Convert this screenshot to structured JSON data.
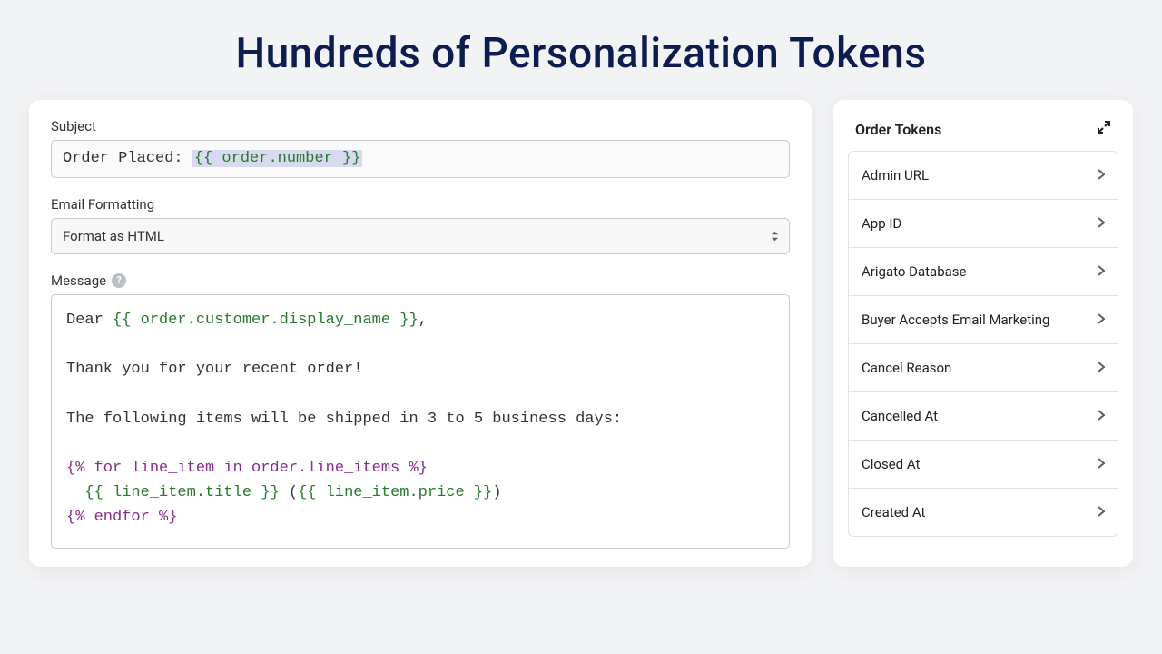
{
  "header": {
    "title": "Hundreds of Personalization Tokens"
  },
  "form": {
    "subject_label": "Subject",
    "subject_prefix": "Order Placed: ",
    "subject_token": "{{ order.number }}",
    "formatting_label": "Email Formatting",
    "formatting_value": "Format as HTML",
    "message_label": "Message",
    "message_lines": [
      {
        "parts": [
          {
            "t": "plain",
            "v": "Dear "
          },
          {
            "t": "var",
            "v": "{{ order.customer.display_name }}"
          },
          {
            "t": "plain",
            "v": ","
          }
        ]
      },
      {
        "parts": [
          {
            "t": "plain",
            "v": ""
          }
        ]
      },
      {
        "parts": [
          {
            "t": "plain",
            "v": "Thank you for your recent order!"
          }
        ]
      },
      {
        "parts": [
          {
            "t": "plain",
            "v": ""
          }
        ]
      },
      {
        "parts": [
          {
            "t": "plain",
            "v": "The following items will be shipped in 3 to 5 business days:"
          }
        ]
      },
      {
        "parts": [
          {
            "t": "plain",
            "v": ""
          }
        ]
      },
      {
        "parts": [
          {
            "t": "tag",
            "v": "{% for line_item in order.line_items %}"
          }
        ]
      },
      {
        "parts": [
          {
            "t": "plain",
            "v": "  "
          },
          {
            "t": "var",
            "v": "{{ line_item.title }}"
          },
          {
            "t": "plain",
            "v": " ("
          },
          {
            "t": "var",
            "v": "{{ line_item.price }}"
          },
          {
            "t": "plain",
            "v": ")"
          }
        ]
      },
      {
        "parts": [
          {
            "t": "tag",
            "v": "{% endfor %}"
          }
        ]
      }
    ]
  },
  "tokens_panel": {
    "title": "Order Tokens",
    "items": [
      "Admin URL",
      "App ID",
      "Arigato Database",
      "Buyer Accepts Email Marketing",
      "Cancel Reason",
      "Cancelled At",
      "Closed At",
      "Created At"
    ]
  }
}
